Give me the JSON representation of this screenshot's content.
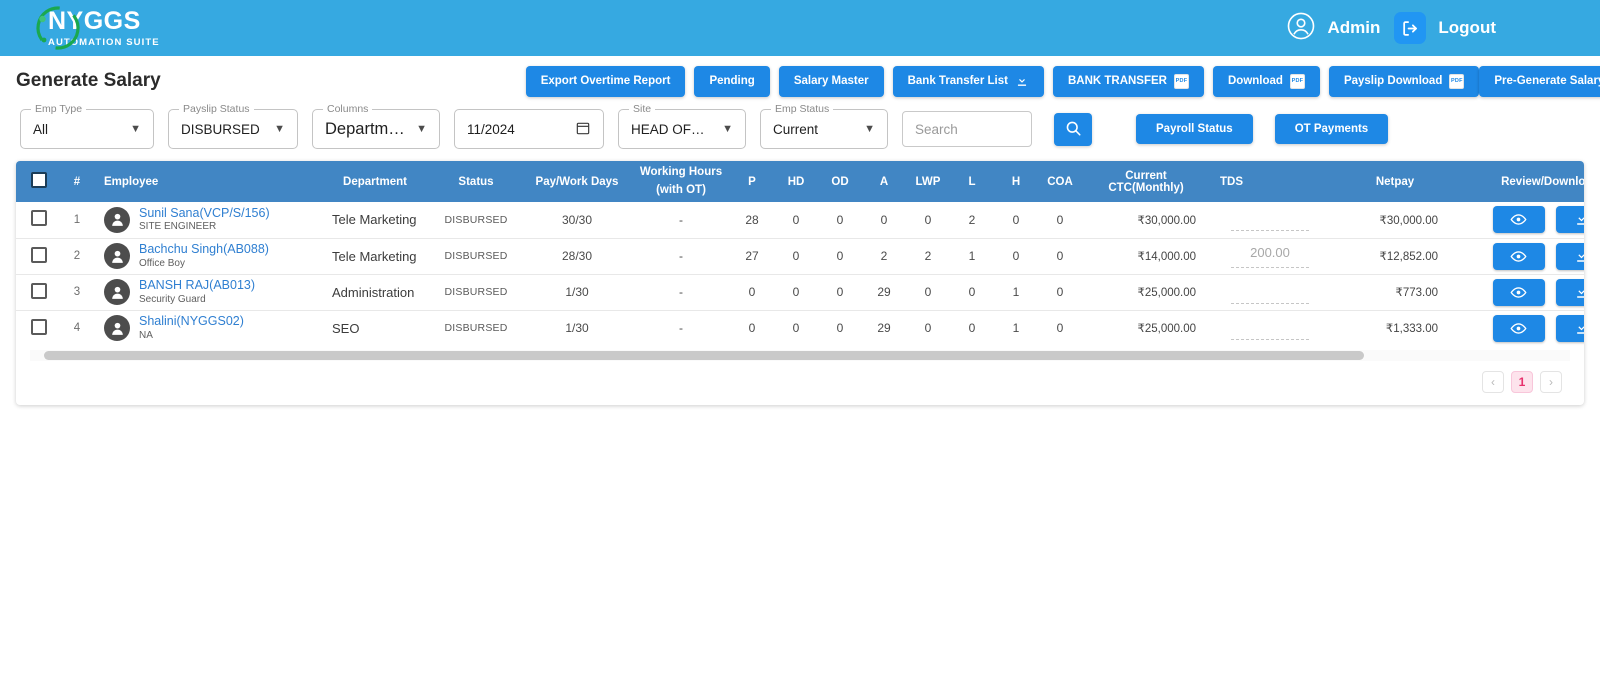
{
  "appbar": {
    "logo_name": "NYGGS",
    "logo_sub": "AUTOMATION SUITE",
    "user_label": "Admin",
    "logout_label": "Logout"
  },
  "page": {
    "title": "Generate Salary"
  },
  "toolbar": {
    "buttons": [
      {
        "label": "Export Overtime Report",
        "icon": "none"
      },
      {
        "label": "Pending",
        "icon": "none"
      },
      {
        "label": "Salary Master",
        "icon": "none"
      },
      {
        "label": "Bank Transfer List",
        "icon": "download-icon"
      },
      {
        "label": "BANK TRANSFER",
        "icon": "pdf-icon"
      },
      {
        "label": "Download",
        "icon": "pdf-icon"
      },
      {
        "label": "Payslip Download",
        "icon": "pdf-icon"
      }
    ],
    "pre_generate_label": "Pre-Generate Salary",
    "pdf_icon_text": "PDF"
  },
  "filters": {
    "emp_type": {
      "legend": "Emp Type",
      "value": "All"
    },
    "payslip_status": {
      "legend": "Payslip Status",
      "value": "DISBURSED"
    },
    "columns": {
      "legend": "Columns",
      "value": "Department,..."
    },
    "date": {
      "value": "11/2024",
      "icon": "calendar-icon"
    },
    "site": {
      "legend": "Site",
      "value": "HEAD OFFICE."
    },
    "emp_status": {
      "legend": "Emp Status",
      "value": "Current"
    },
    "search": {
      "placeholder": "Search",
      "value": "",
      "icon": "search-icon"
    },
    "payroll_status_label": "Payroll Status",
    "ot_payments_label": "OT Payments"
  },
  "table": {
    "headers": {
      "index": "#",
      "employee": "Employee",
      "department": "Department",
      "status": "Status",
      "pay_work_days": "Pay/Work Days",
      "working_hours_line1": "Working Hours",
      "working_hours_line2": "(with OT)",
      "p": "P",
      "hd": "HD",
      "od": "OD",
      "a": "A",
      "lwp": "LWP",
      "l": "L",
      "h": "H",
      "coa": "COA",
      "current_ctc": "Current CTC(Monthly)",
      "tds": "TDS",
      "netpay": "Netpay",
      "review_download": "Review/Download"
    },
    "rows": [
      {
        "index": "1",
        "name": "Sunil Sana(VCP/S/156)",
        "role": "SITE ENGINEER",
        "department": "Tele Marketing",
        "status": "DISBURSED",
        "pay_work_days": "30/30",
        "working_hours": "-",
        "p": "28",
        "hd": "0",
        "od": "0",
        "a": "0",
        "lwp": "0",
        "l": "2",
        "h": "0",
        "coa": "0",
        "current_ctc": "₹30,000.00",
        "tds": "",
        "netpay": "₹30,000.00"
      },
      {
        "index": "2",
        "name": "Bachchu Singh(AB088)",
        "role": "Office Boy",
        "department": "Tele Marketing",
        "status": "DISBURSED",
        "pay_work_days": "28/30",
        "working_hours": "-",
        "p": "27",
        "hd": "0",
        "od": "0",
        "a": "2",
        "lwp": "2",
        "l": "1",
        "h": "0",
        "coa": "0",
        "current_ctc": "₹14,000.00",
        "tds": "200.00",
        "netpay": "₹12,852.00"
      },
      {
        "index": "3",
        "name": "BANSH RAJ(AB013)",
        "role": "Security Guard",
        "department": "Administration",
        "status": "DISBURSED",
        "pay_work_days": "1/30",
        "working_hours": "-",
        "p": "0",
        "hd": "0",
        "od": "0",
        "a": "29",
        "lwp": "0",
        "l": "0",
        "h": "1",
        "coa": "0",
        "current_ctc": "₹25,000.00",
        "tds": "",
        "netpay": "₹773.00"
      },
      {
        "index": "4",
        "name": "Shalini(NYGGS02)",
        "role": "NA",
        "department": "SEO",
        "status": "DISBURSED",
        "pay_work_days": "1/30",
        "working_hours": "-",
        "p": "0",
        "hd": "0",
        "od": "0",
        "a": "29",
        "lwp": "0",
        "l": "0",
        "h": "1",
        "coa": "0",
        "current_ctc": "₹25,000.00",
        "tds": "",
        "netpay": "₹1,333.00"
      }
    ]
  },
  "pagination": {
    "prev": "‹",
    "page": "1",
    "next": "›"
  },
  "colors": {
    "appbar": "#36a9e1",
    "primary_button": "#1e88e5",
    "table_header": "#4186c4",
    "link": "#2f7fd1",
    "pagination_active": "#e7316d"
  }
}
